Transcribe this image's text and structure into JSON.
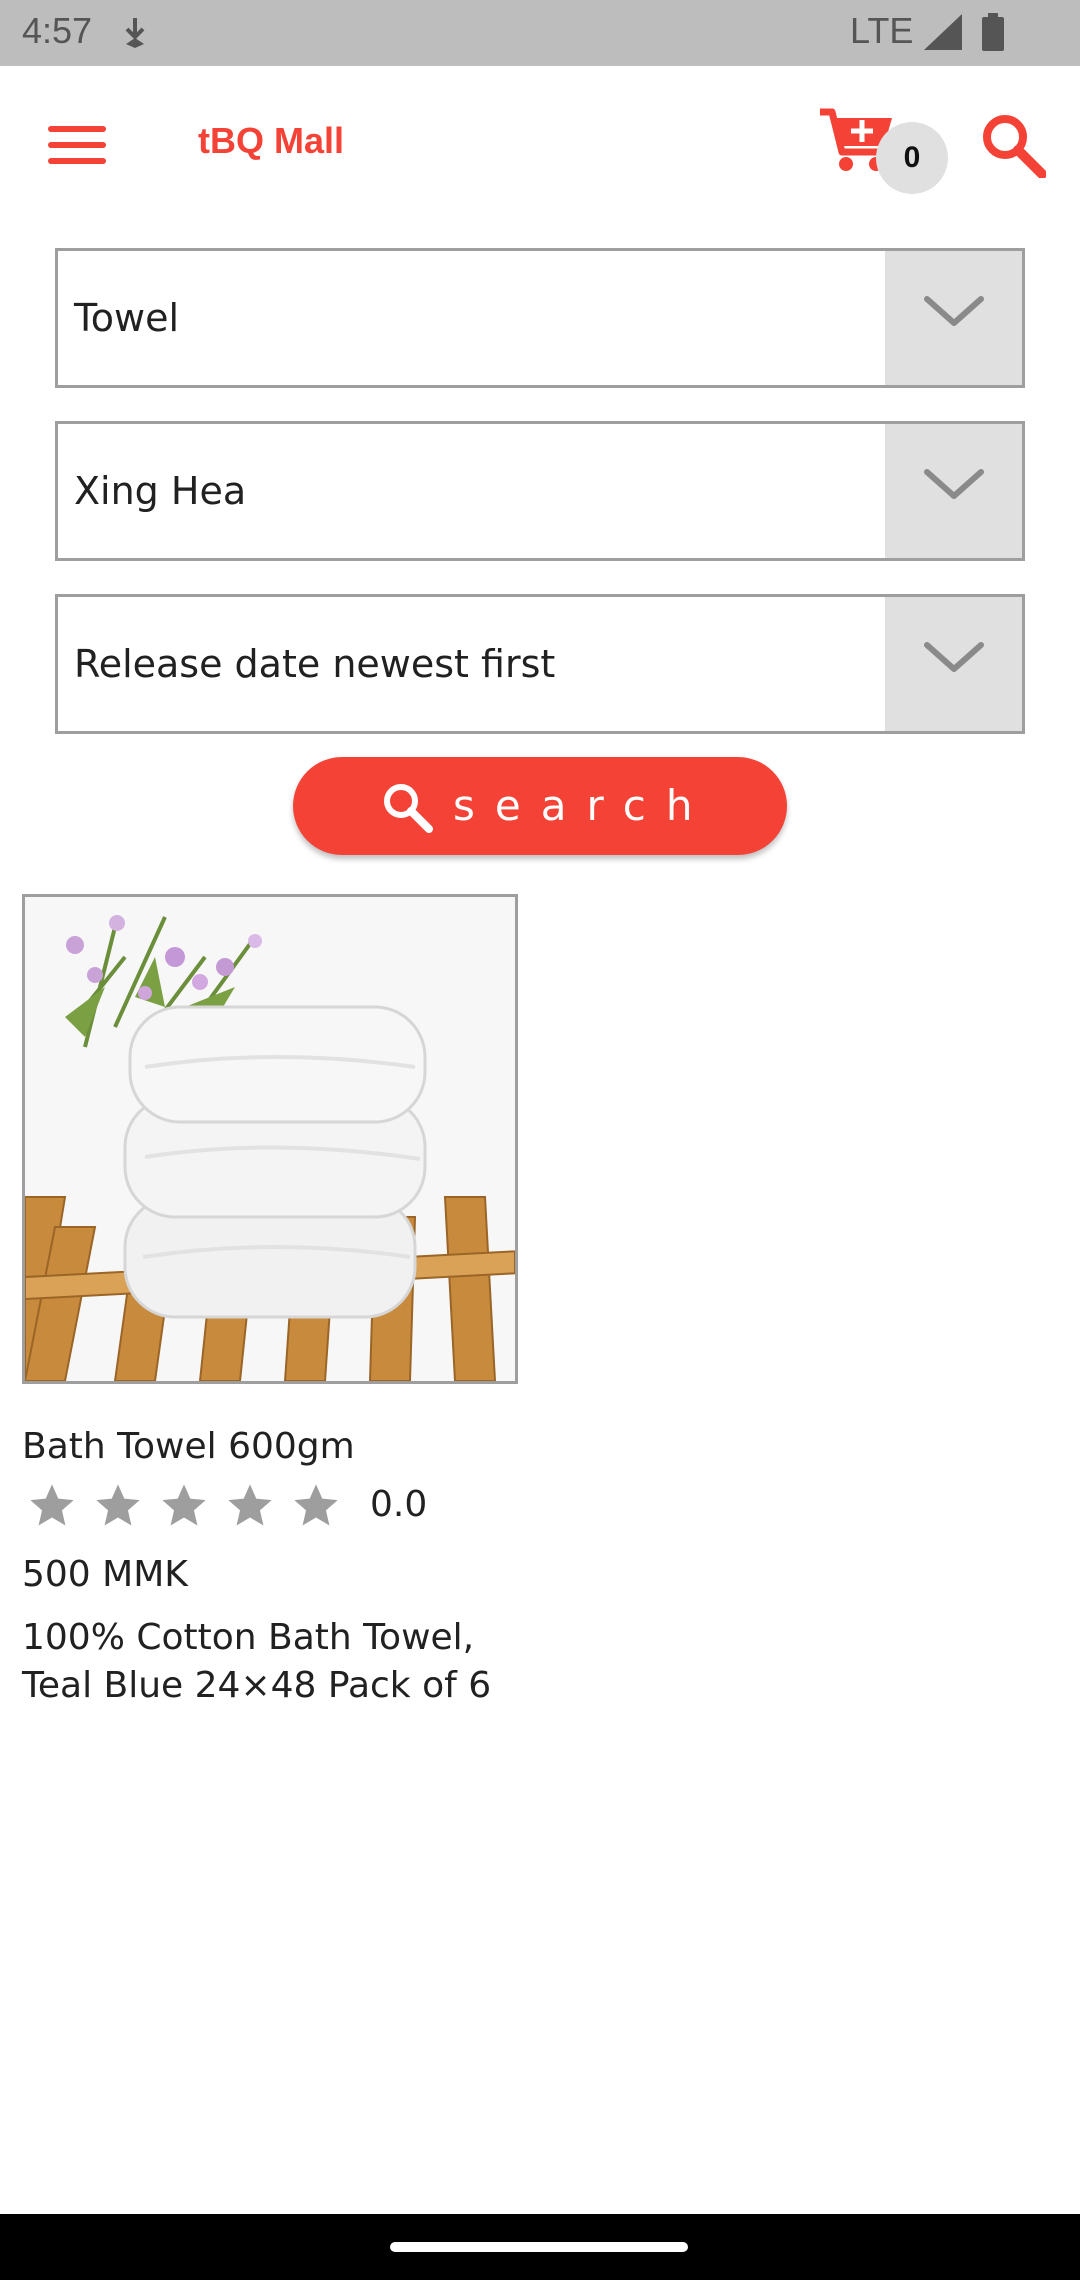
{
  "status_bar": {
    "time": "4:57",
    "network": "LTE",
    "icons": [
      "download-icon",
      "signal-icon",
      "battery-icon"
    ]
  },
  "app_bar": {
    "title": "tBQ Mall",
    "cart_count": "0",
    "icons": [
      "menu-icon",
      "cart-add-icon",
      "search-icon"
    ]
  },
  "filters": [
    {
      "value": "Towel"
    },
    {
      "value": "Xing Hea"
    },
    {
      "value": "Release date newest first"
    }
  ],
  "search_button": {
    "label": "search",
    "icon": "search-icon"
  },
  "products": [
    {
      "name": "Bath Towel 600gm",
      "rating": "0.0",
      "stars_max": 5,
      "price": "500 MMK",
      "description": "100% Cotton Bath Towel, Teal Blue 24×48 Pack of 6",
      "image": "folded-towels-image"
    }
  ],
  "colors": {
    "accent": "#f44336",
    "status_bar": "#bdbdbd",
    "dropdown_arrow_bg": "#e0e0e0",
    "star": "#9e9e9e"
  }
}
